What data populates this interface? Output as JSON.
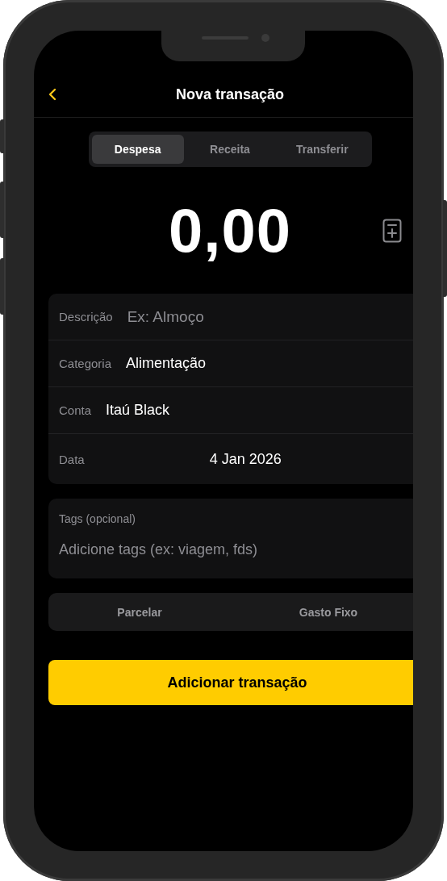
{
  "header": {
    "title": "Nova transação"
  },
  "tabs": [
    {
      "label": "Despesa",
      "selected": true
    },
    {
      "label": "Receita",
      "selected": false
    },
    {
      "label": "Transferir",
      "selected": false
    }
  ],
  "amount": "0,00",
  "fields": [
    {
      "kind": "input",
      "label": "Descrição",
      "placeholder": "Ex: Almoço"
    },
    {
      "kind": "select",
      "label": "Categoria",
      "value": "Alimentação"
    },
    {
      "kind": "select",
      "label": "Conta",
      "value": "Itaú Black"
    },
    {
      "kind": "date",
      "label": "Data",
      "value": "4 Jan 2026"
    }
  ],
  "tags": {
    "label": "Tags (opcional)",
    "placeholder": "Adicione tags (ex: viagem, fds)"
  },
  "options": [
    {
      "label": "Parcelar"
    },
    {
      "label": "Gasto Fixo"
    }
  ],
  "submit": "Adicionar transação"
}
